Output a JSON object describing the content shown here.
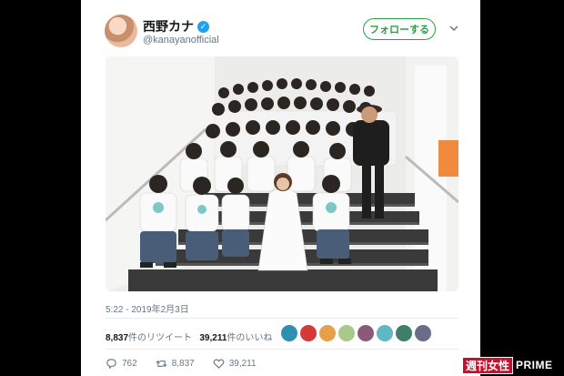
{
  "tweet": {
    "display_name": "西野カナ",
    "handle": "@kanayanofficial",
    "follow_label": "フォローする",
    "timestamp": "5:22 - 2019年2月3日",
    "retweet_count": "8,837",
    "retweet_label": "件のリツイート",
    "like_count": "39,211",
    "like_label": "件のいいね",
    "actions": {
      "reply_count": "762",
      "retweet_count": "8,837",
      "like_count": "39,211"
    }
  },
  "watermark": {
    "part1": "週刊女性",
    "part2": "PRIME"
  },
  "colors": {
    "follow": "#2aa146",
    "verified": "#1da1f2",
    "watermark_red": "#c8102e"
  },
  "icons": [
    "verified-icon",
    "chevron-down-icon",
    "reply-icon",
    "retweet-icon",
    "like-icon"
  ]
}
